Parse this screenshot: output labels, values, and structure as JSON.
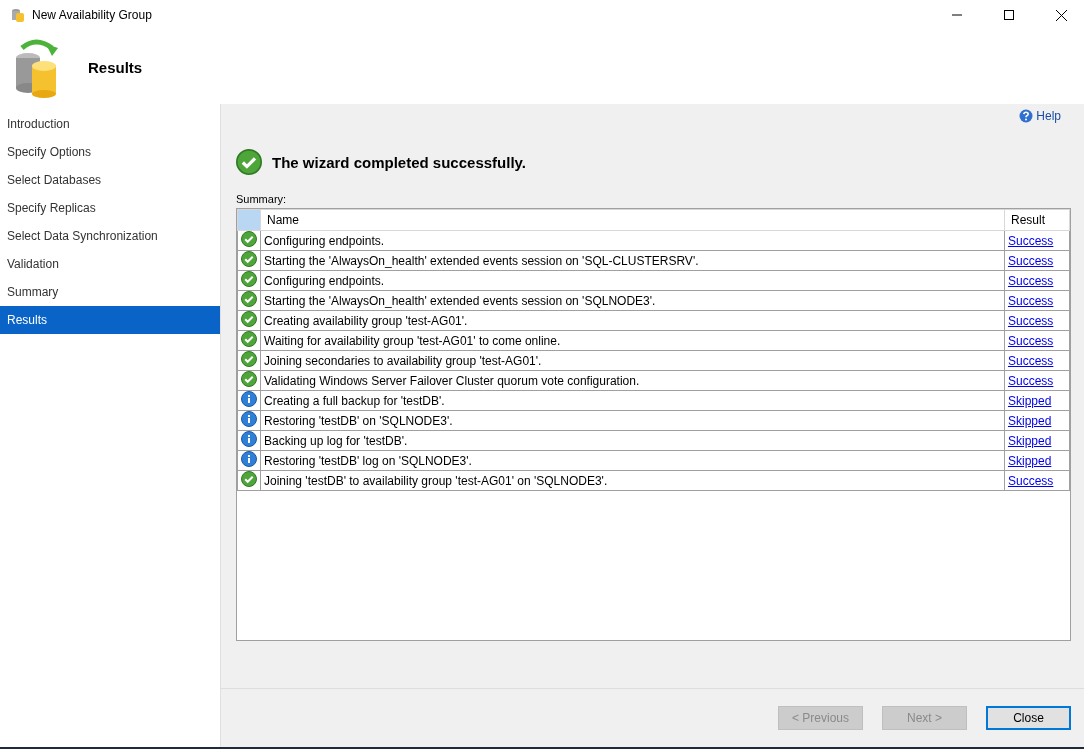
{
  "window": {
    "title": "New Availability Group"
  },
  "header": {
    "title": "Results"
  },
  "sidebar": {
    "items": [
      {
        "label": "Introduction",
        "selected": false
      },
      {
        "label": "Specify Options",
        "selected": false
      },
      {
        "label": "Select Databases",
        "selected": false
      },
      {
        "label": "Specify Replicas",
        "selected": false
      },
      {
        "label": "Select Data Synchronization",
        "selected": false
      },
      {
        "label": "Validation",
        "selected": false
      },
      {
        "label": "Summary",
        "selected": false
      },
      {
        "label": "Results",
        "selected": true
      }
    ]
  },
  "help": "Help",
  "status": {
    "kind": "success",
    "message": "The wizard completed successfully."
  },
  "summary_label": "Summary:",
  "table": {
    "columns": [
      "Name",
      "Result"
    ],
    "rows": [
      {
        "kind": "success",
        "name": "Configuring endpoints.",
        "result": "Success"
      },
      {
        "kind": "success",
        "name": "Starting the 'AlwaysOn_health' extended events session on 'SQL-CLUSTERSRV'.",
        "result": "Success"
      },
      {
        "kind": "success",
        "name": "Configuring endpoints.",
        "result": "Success"
      },
      {
        "kind": "success",
        "name": "Starting the 'AlwaysOn_health' extended events session on 'SQLNODE3'.",
        "result": "Success"
      },
      {
        "kind": "success",
        "name": "Creating availability group 'test-AG01'.",
        "result": "Success"
      },
      {
        "kind": "success",
        "name": "Waiting for availability group 'test-AG01' to come online.",
        "result": "Success"
      },
      {
        "kind": "success",
        "name": "Joining secondaries to availability group 'test-AG01'.",
        "result": "Success"
      },
      {
        "kind": "success",
        "name": "Validating Windows Server Failover Cluster quorum vote configuration.",
        "result": "Success"
      },
      {
        "kind": "info",
        "name": "Creating a full backup for 'testDB'.",
        "result": "Skipped"
      },
      {
        "kind": "info",
        "name": "Restoring 'testDB' on 'SQLNODE3'.",
        "result": "Skipped"
      },
      {
        "kind": "info",
        "name": "Backing up log for 'testDB'.",
        "result": "Skipped"
      },
      {
        "kind": "info",
        "name": "Restoring 'testDB' log on 'SQLNODE3'.",
        "result": "Skipped"
      },
      {
        "kind": "success",
        "name": "Joining 'testDB' to availability group 'test-AG01' on 'SQLNODE3'.",
        "result": "Success"
      }
    ]
  },
  "buttons": [
    {
      "label": "< Previous",
      "disabled": true,
      "default": false
    },
    {
      "label": "Next >",
      "disabled": true,
      "default": false
    },
    {
      "label": "Close",
      "disabled": false,
      "default": true
    }
  ]
}
